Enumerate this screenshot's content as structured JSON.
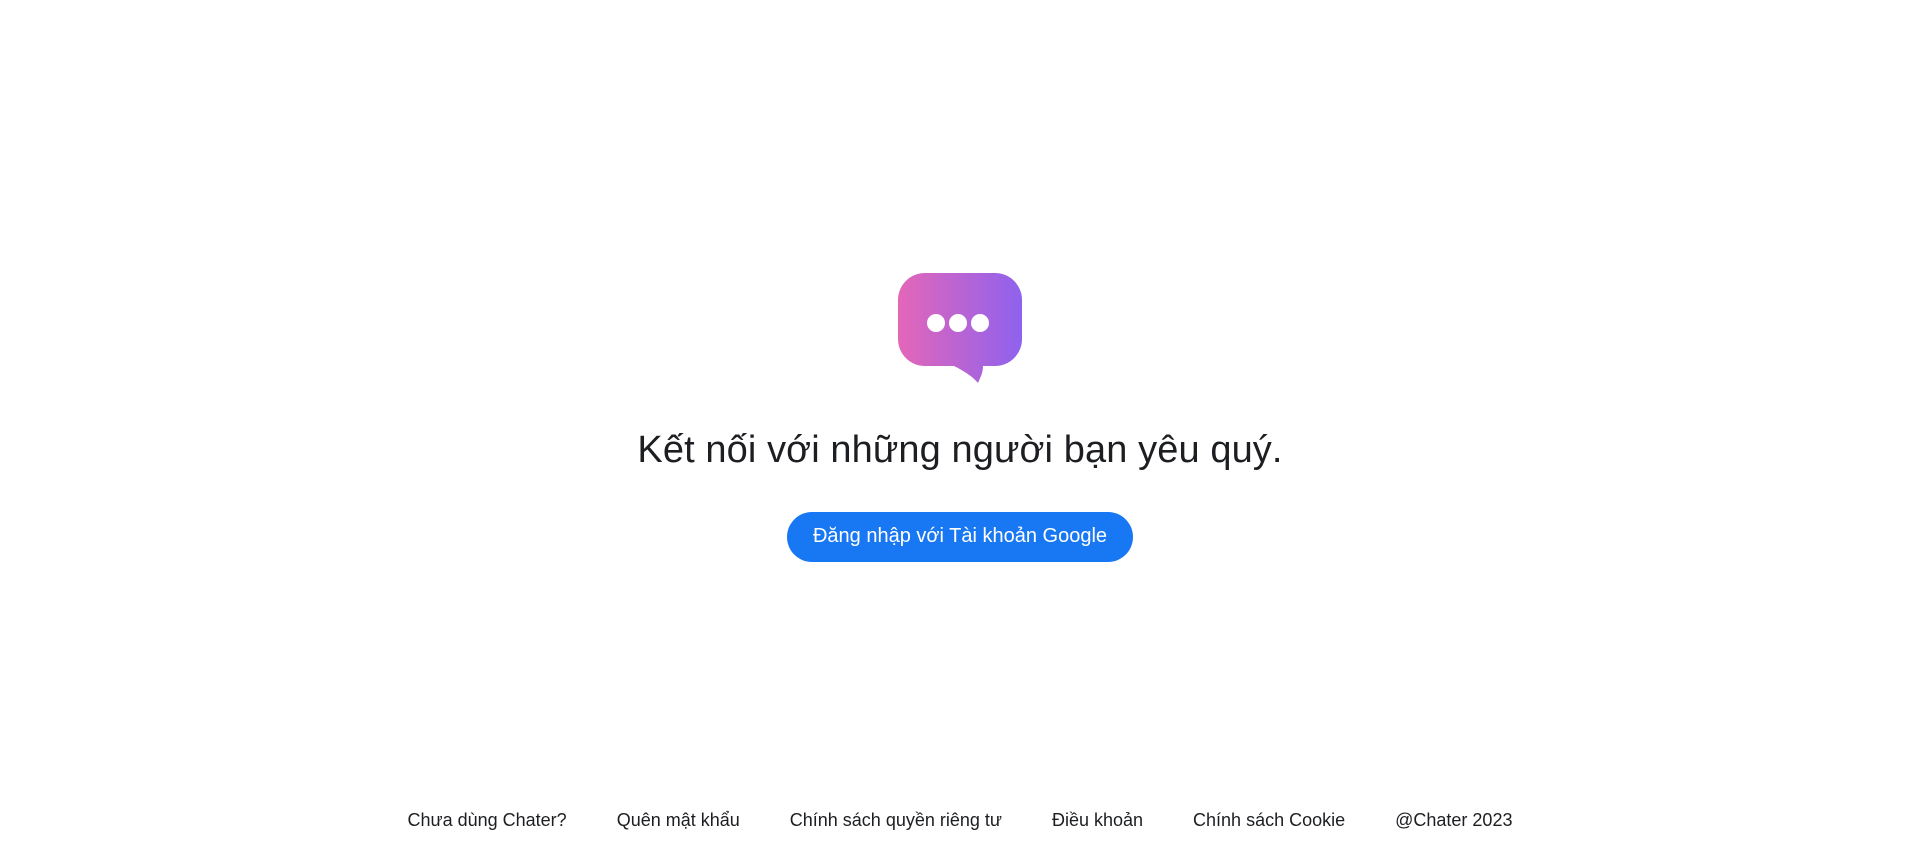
{
  "main": {
    "tagline": "Kết nối với những người bạn yêu quý.",
    "login_button_label": "Đăng nhập với Tài khoản Google",
    "logo_icon": "chat-bubble-icon",
    "colors": {
      "logo_gradient_start": "#e466b8",
      "logo_gradient_end": "#8e62ee",
      "button_bg": "#1877f2",
      "button_text": "#ffffff",
      "text": "#1c1e21"
    }
  },
  "footer": {
    "links": [
      "Chưa dùng Chater?",
      "Quên mật khẩu",
      "Chính sách quyền riêng tư",
      "Điều khoản",
      "Chính sách Cookie"
    ],
    "copyright": "@Chater 2023"
  }
}
